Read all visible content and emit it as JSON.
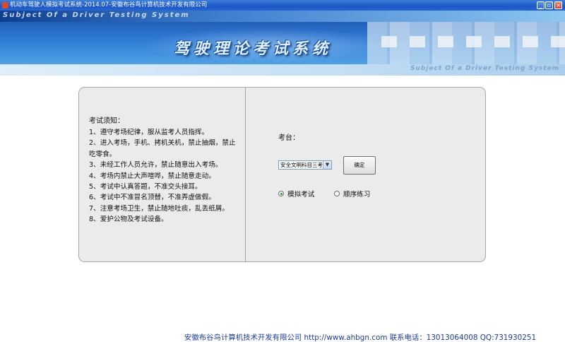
{
  "window": {
    "title": "机动车驾驶人模拟考试系统-2014.07-安徽布谷鸟计算机技术开发有限公司",
    "controls": [
      "_",
      "▫",
      "×"
    ]
  },
  "banner": {
    "subtitle_top": "Subject Of a Driver Testing System",
    "main_title": "驾驶理论考试系统",
    "subtitle_bottom": "Subject Of a Driver Testing System"
  },
  "notice": {
    "title": "考试须知：",
    "items": [
      "1、遵守考场纪律，服从监考人员指挥。",
      "2、进入考场，手机、拷机关机，禁止抽烟，禁止吃零食。",
      "3、未经工作人员允许，禁止随意出入考场。",
      "4、考场内禁止大声喧哗，禁止随意走动。",
      "5、考试中认真答题，不准交头接耳。",
      "6、考试中不准冒名顶替，不准弄虚做假。",
      "7、注意考场卫生，禁止随地吐痰，乱丢纸屑。",
      "8、爱护公物及考试设备。"
    ]
  },
  "console": {
    "label": "考台：",
    "select_value": "安全文明科目三考",
    "confirm_button": "确定",
    "mode_mock": "模拟考试",
    "mode_sequence": "顺序练习"
  },
  "footer": {
    "text": "安徽布谷鸟计算机技术开发有限公司 http://www.ahbgn.com 联系电话：13013064008 QQ:731930251"
  }
}
